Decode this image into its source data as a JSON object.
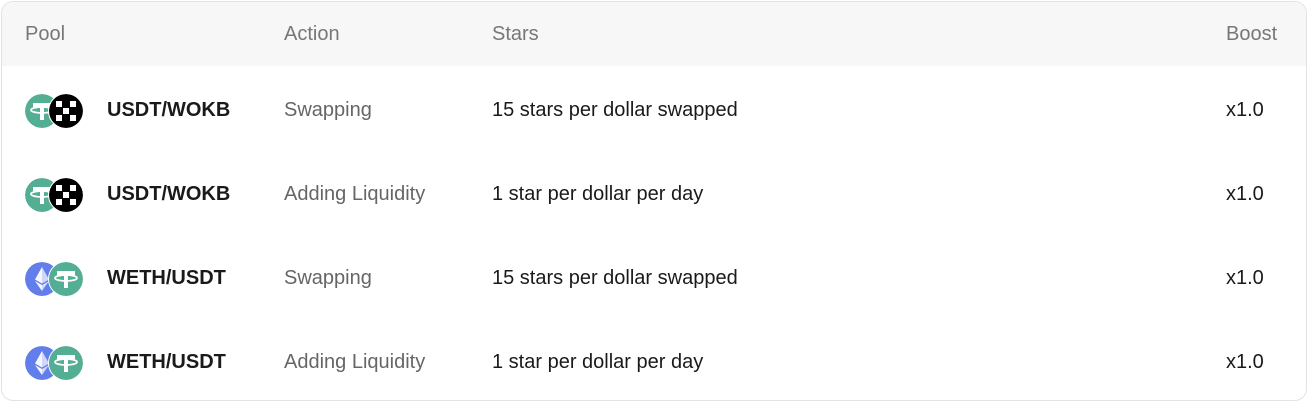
{
  "table": {
    "headers": {
      "pool": "Pool",
      "action": "Action",
      "stars": "Stars",
      "boost": "Boost"
    },
    "rows": [
      {
        "pool": "USDT/WOKB",
        "icons": [
          "tether-icon",
          "okb-icon"
        ],
        "action": "Swapping",
        "stars": "15 stars per dollar swapped",
        "boost": "x1.0"
      },
      {
        "pool": "USDT/WOKB",
        "icons": [
          "tether-icon",
          "okb-icon"
        ],
        "action": "Adding Liquidity",
        "stars": "1 star per dollar per day",
        "boost": "x1.0"
      },
      {
        "pool": "WETH/USDT",
        "icons": [
          "ethereum-icon",
          "tether-icon"
        ],
        "action": "Swapping",
        "stars": "15 stars per dollar swapped",
        "boost": "x1.0"
      },
      {
        "pool": "WETH/USDT",
        "icons": [
          "ethereum-icon",
          "tether-icon"
        ],
        "action": "Adding Liquidity",
        "stars": "1 star per dollar per day",
        "boost": "x1.0"
      }
    ]
  },
  "colors": {
    "tether": "#53ae94",
    "ethereum": "#627eea",
    "okb": "#000000",
    "header_bg": "#f7f7f7",
    "border": "#e3e3e3"
  }
}
